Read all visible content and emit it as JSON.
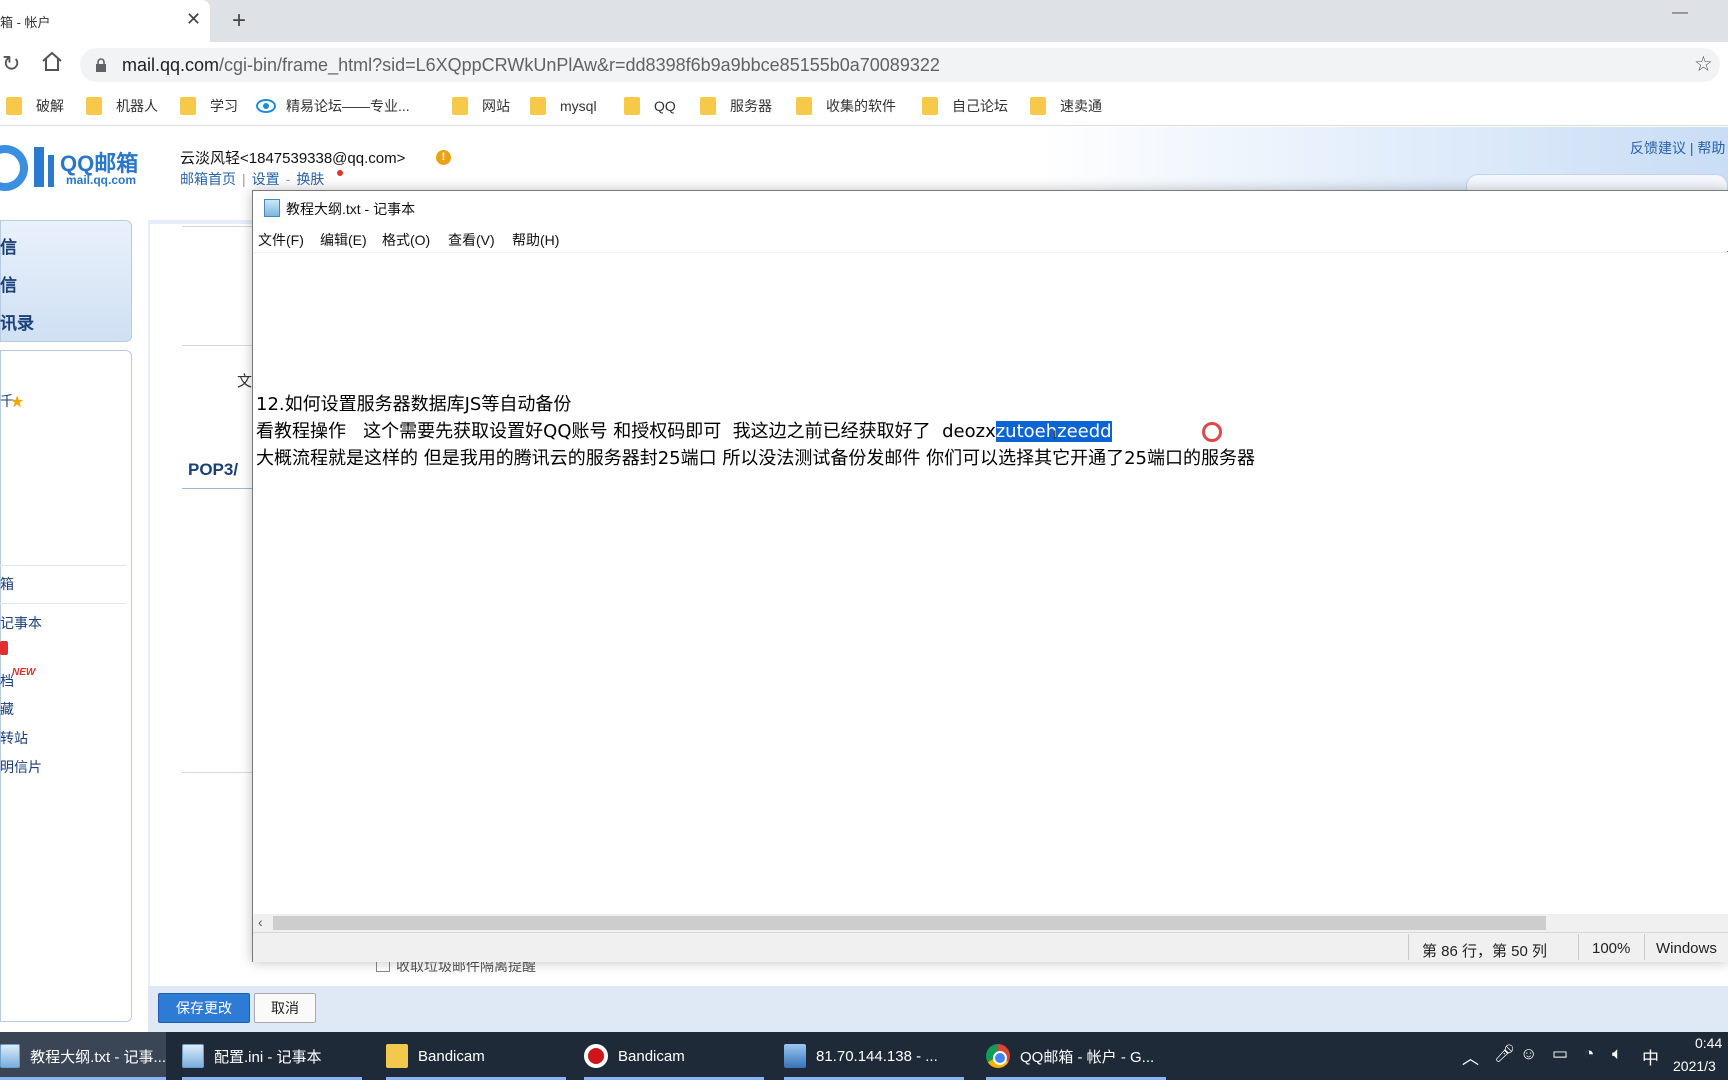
{
  "browser": {
    "tab_title": "箱 - 帐户",
    "tab_close": "✕",
    "new_tab": "+",
    "url_host": "mail.qq.com",
    "url_path": "/cgi-bin/frame_html?sid=L6XQppCRWkUnPlAw&r=dd8398f6b9a9bbce85155b0a70089322",
    "bookmarks": [
      "破解",
      "机器人",
      "学习",
      "精易论坛——专业...",
      "网站",
      "mysql",
      "QQ",
      "服务器",
      "收集的软件",
      "自己论坛",
      "速卖通"
    ]
  },
  "mail": {
    "logo_text": "QQ邮箱",
    "logo_sub": "mail.qq.com",
    "user": "云淡风轻<1847539338@qq.com>",
    "links": [
      "邮箱首页",
      "设置",
      "换肤"
    ],
    "feedback": "反馈建议 | 帮助",
    "nav_big": [
      "信",
      "信",
      "讯录"
    ],
    "nav_small": [
      "千",
      "箱",
      "记事本",
      "档",
      "藏",
      "转站",
      "明信片"
    ],
    "new_badge": "NEW",
    "content_wen": "文",
    "pop3_label": "POP3/",
    "hidden_checkbox_text": "收取垃圾邮件隔离提醒",
    "save_button": "保存更改",
    "cancel_button": "取消"
  },
  "notepad": {
    "title": "教程大纲.txt - 记事本",
    "menus": [
      "文件(F)",
      "编辑(E)",
      "格式(O)",
      "查看(V)",
      "帮助(H)"
    ],
    "line1": "12.如何设置服务器数据库JS等自动备份",
    "line2_prefix": "看教程操作   这个需要先获取设置好QQ账号 和授权码即可  我这边之前已经获取好了  deo",
    "line2_mid": "zx",
    "line2_selected": "zutoehzeedd",
    "line3": "大概流程就是这样的 但是我用的腾讯云的服务器封25端口 所以没法测试备份发邮件 你们可以选择其它开通了25端口的服务器",
    "status_position": "第 86 行，第 50 列",
    "status_zoom": "100%",
    "status_eol": "Windows"
  },
  "taskbar": {
    "items": [
      "教程大纲.txt - 记事...",
      "配置.ini - 记事本",
      "Bandicam",
      "Bandicam",
      "81.70.144.138 - ...",
      "QQ邮箱 - 帐户 - G..."
    ],
    "ime": "中",
    "time": "0:44",
    "date": "2021/3"
  }
}
